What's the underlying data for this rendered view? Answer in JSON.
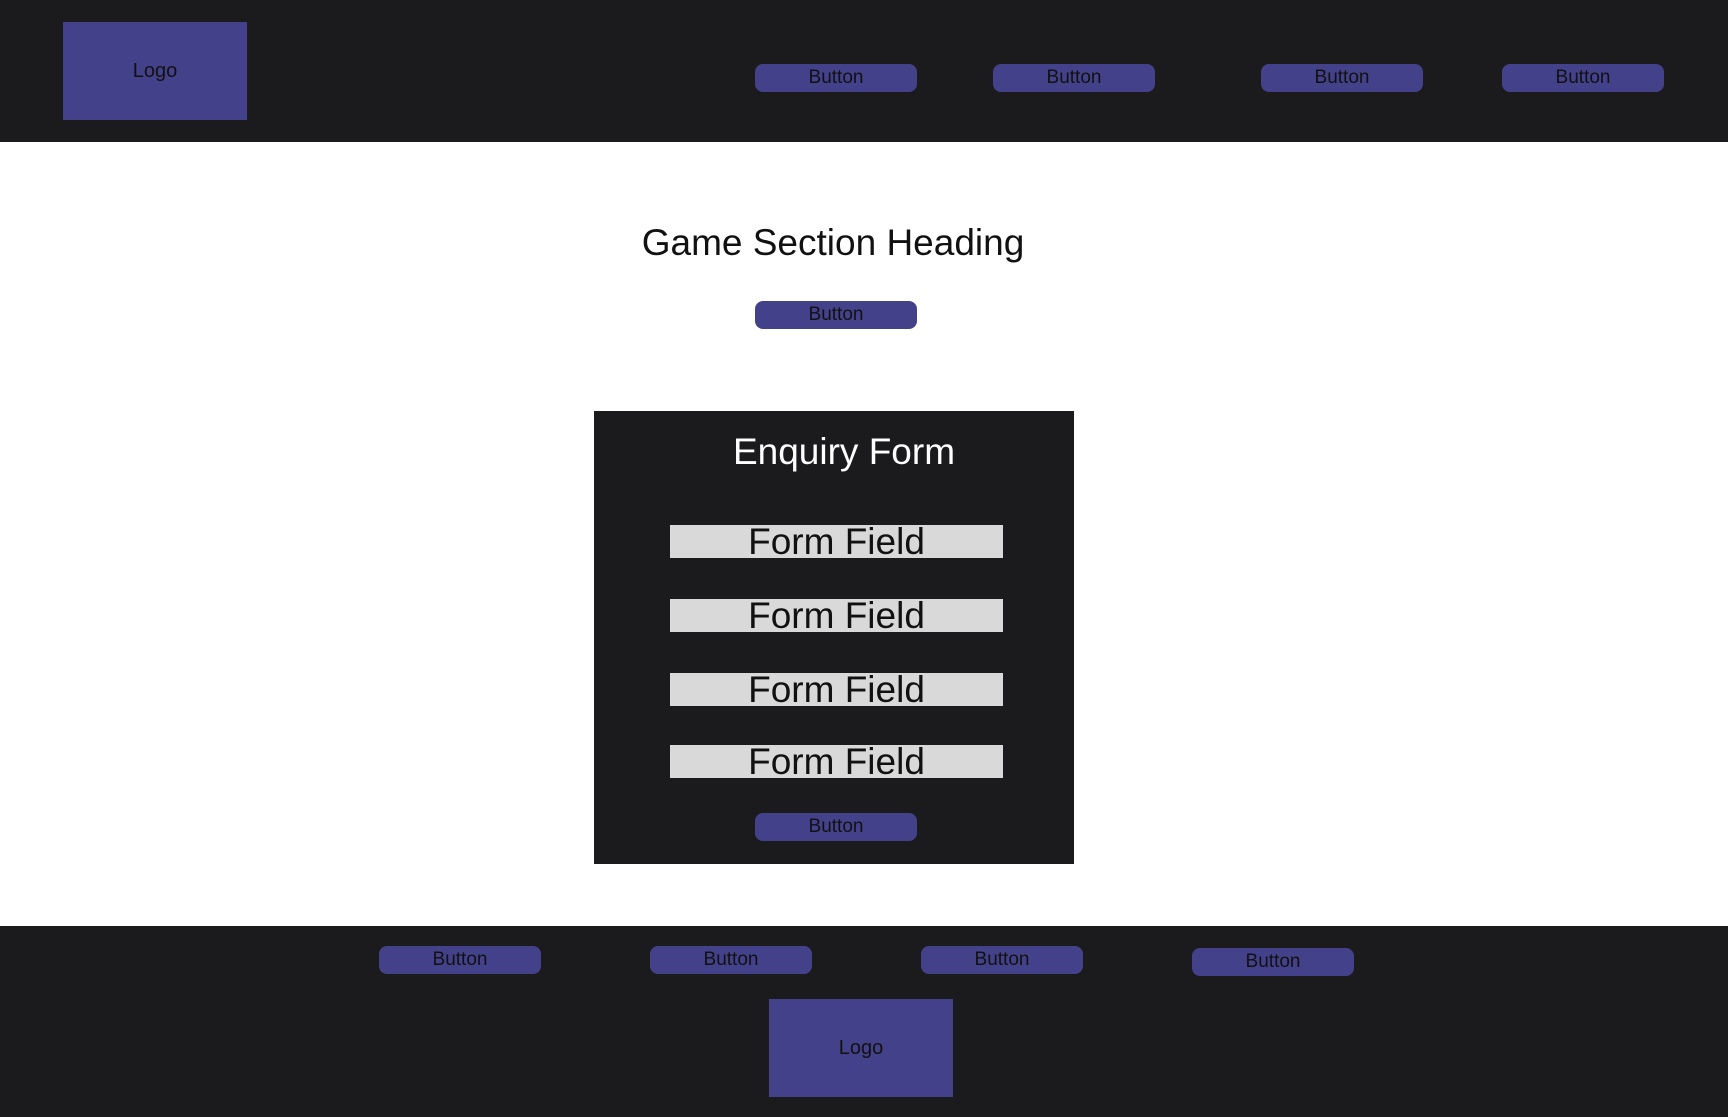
{
  "header": {
    "logo_label": "Logo",
    "nav_buttons": [
      "Button",
      "Button",
      "Button",
      "Button"
    ]
  },
  "main": {
    "heading": "Game Section Heading",
    "cta_button": "Button"
  },
  "form": {
    "title": "Enquiry Form",
    "fields": [
      "Form Field",
      "Form Field",
      "Form Field",
      "Form Field"
    ],
    "submit_button": "Button"
  },
  "footer": {
    "nav_buttons": [
      "Button",
      "Button",
      "Button",
      "Button"
    ],
    "logo_label": "Logo"
  },
  "colors": {
    "dark_background": "#1b1b1e",
    "accent": "#43418a",
    "field_background": "#d9d9d9",
    "page_background": "#ffffff"
  }
}
